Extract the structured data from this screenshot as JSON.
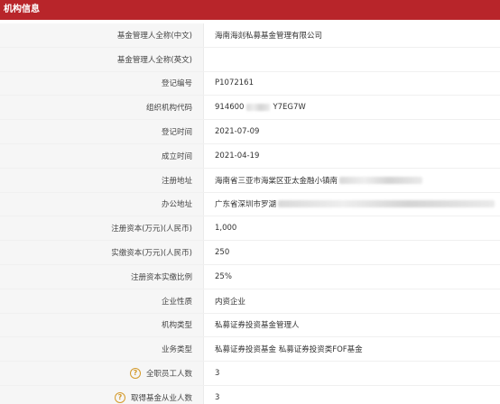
{
  "header": {
    "title": "机构信息"
  },
  "rows": [
    {
      "label": "基金管理人全称(中文)",
      "value": "海南海剡私募基金管理有限公司"
    },
    {
      "label": "基金管理人全称(英文)",
      "value": ""
    },
    {
      "label": "登记编号",
      "value": "P1072161"
    },
    {
      "label": "组织机构代码",
      "value_prefix": "914600",
      "value_suffix": "Y7EG7W"
    },
    {
      "label": "登记时间",
      "value": "2021-07-09"
    },
    {
      "label": "成立时间",
      "value": "2021-04-19"
    },
    {
      "label": "注册地址",
      "value": "海南省三亚市海棠区亚太金融小镇南"
    },
    {
      "label": "办公地址",
      "value": "广东省深圳市罗湖"
    },
    {
      "label": "注册资本(万元)(人民币)",
      "value": "1,000"
    },
    {
      "label": "实缴资本(万元)(人民币)",
      "value": "250"
    },
    {
      "label": "注册资本实缴比例",
      "value": "25%"
    },
    {
      "label": "企业性质",
      "value": "内资企业"
    },
    {
      "label": "机构类型",
      "value": "私募证券投资基金管理人"
    },
    {
      "label": "业务类型",
      "value": "私募证券投资基金  私募证券投资类FOF基金"
    },
    {
      "label": "全职员工人数",
      "value": "3",
      "help": "?"
    },
    {
      "label": "取得基金从业人数",
      "value": "3",
      "help": "?"
    }
  ]
}
